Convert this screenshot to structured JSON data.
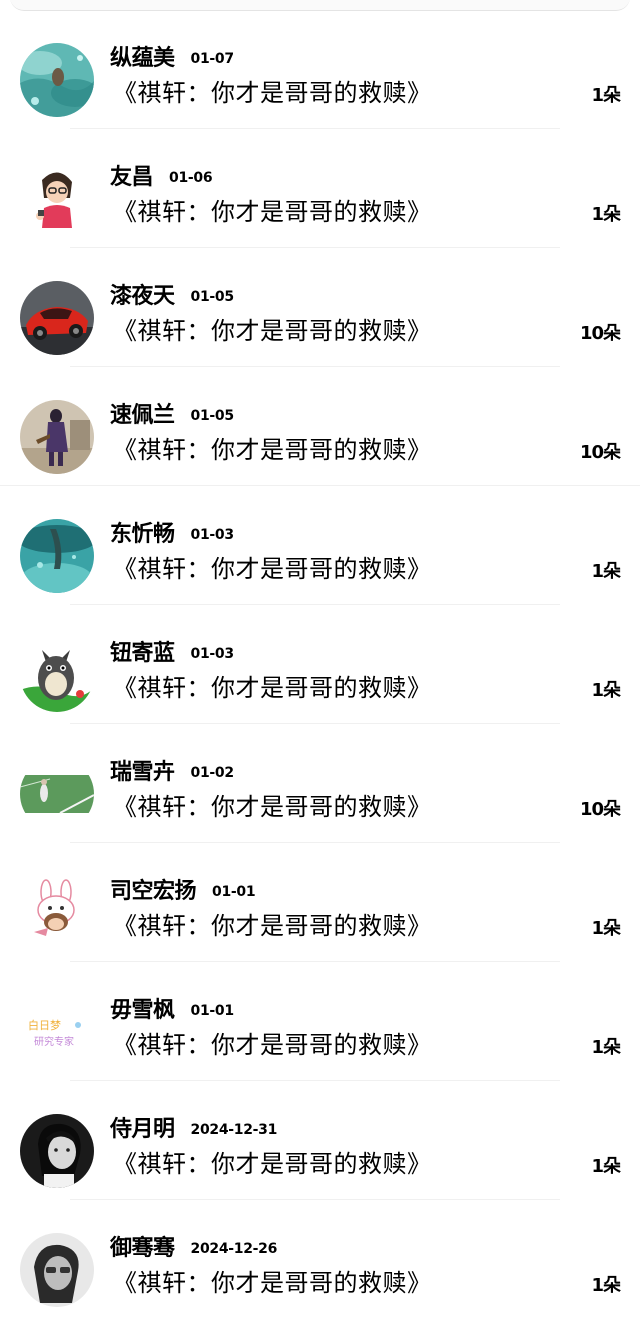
{
  "rows": [
    {
      "name": "纵蕴美",
      "date": "01-07",
      "title": "《祺轩：你才是哥哥的救赎》",
      "count": "1朵",
      "avatar": "water-avatar"
    },
    {
      "name": "友昌",
      "date": "01-06",
      "title": "《祺轩：你才是哥哥的救赎》",
      "count": "1朵",
      "avatar": "cartoon-girl-avatar"
    },
    {
      "name": "漆夜天",
      "date": "01-05",
      "title": "《祺轩：你才是哥哥的救赎》",
      "count": "10朵",
      "avatar": "red-car-avatar"
    },
    {
      "name": "速佩兰",
      "date": "01-05",
      "title": "《祺轩：你才是哥哥的救赎》",
      "count": "10朵",
      "avatar": "game-character-avatar"
    },
    {
      "name": "东忻畅",
      "date": "01-03",
      "title": "《祺轩：你才是哥哥的救赎》",
      "count": "1朵",
      "avatar": "underwater-avatar"
    },
    {
      "name": "钮寄蓝",
      "date": "01-03",
      "title": "《祺轩：你才是哥哥的救赎》",
      "count": "1朵",
      "avatar": "totoro-avatar"
    },
    {
      "name": "瑞雪卉",
      "date": "01-02",
      "title": "《祺轩：你才是哥哥的救赎》",
      "count": "10朵",
      "avatar": "soccer-field-avatar"
    },
    {
      "name": "司空宏扬",
      "date": "01-01",
      "title": "《祺轩：你才是哥哥的救赎》",
      "count": "1朵",
      "avatar": "bunny-hat-avatar"
    },
    {
      "name": "毋雪枫",
      "date": "01-01",
      "title": "《祺轩：你才是哥哥的救赎》",
      "count": "1朵",
      "avatar": "text-sticker-avatar"
    },
    {
      "name": "侍月明",
      "date": "2024-12-31",
      "title": "《祺轩：你才是哥哥的救赎》",
      "count": "1朵",
      "avatar": "bw-portrait-avatar"
    },
    {
      "name": "御骞骞",
      "date": "2024-12-26",
      "title": "《祺轩：你才是哥哥的救赎》",
      "count": "1朵",
      "avatar": "bw-man-avatar"
    }
  ],
  "sticker_text": {
    "line1": "白日梦",
    "line2": "研究专家"
  }
}
